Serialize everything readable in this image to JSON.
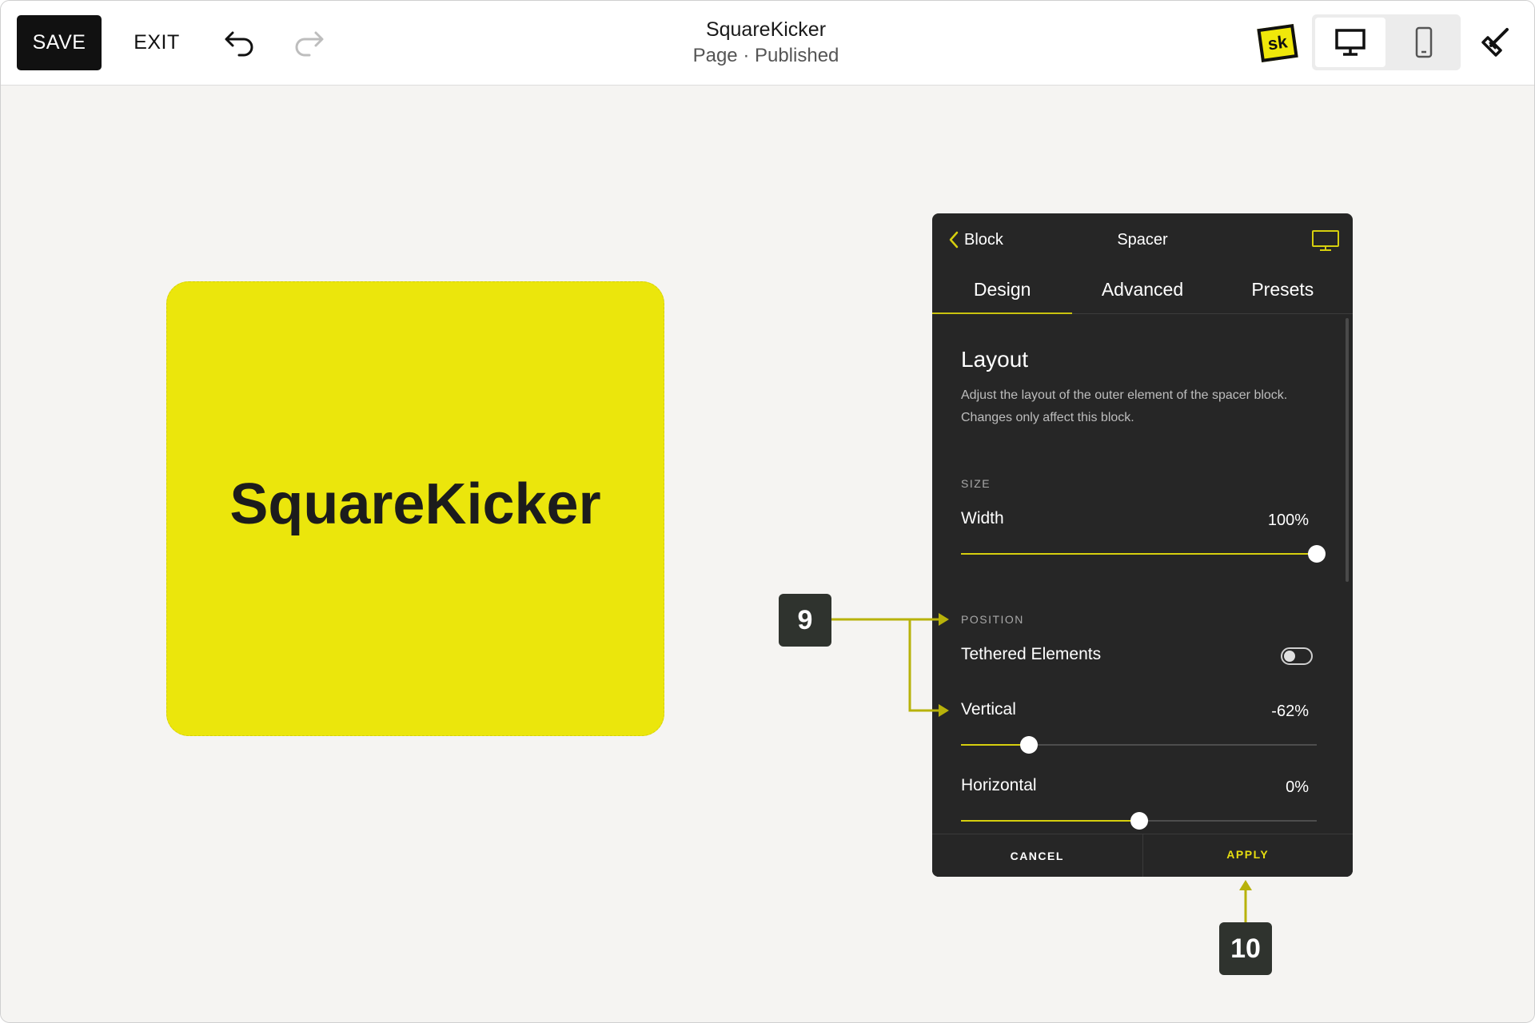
{
  "topbar": {
    "save_label": "SAVE",
    "exit_label": "EXIT",
    "site_title": "SquareKicker",
    "site_subtitle": "Page · Published",
    "logo_text": "sk"
  },
  "canvas": {
    "block_text": "SquareKicker",
    "block_color": "#ebe60c"
  },
  "panel": {
    "back_label": "Block",
    "title": "Spacer",
    "tabs": [
      {
        "label": "Design",
        "active": true
      },
      {
        "label": "Advanced",
        "active": false
      },
      {
        "label": "Presets",
        "active": false
      }
    ],
    "section_title": "Layout",
    "section_description": "Adjust the layout of the outer element of the spacer block. Changes only affect this block.",
    "size_group_label": "SIZE",
    "width": {
      "label": "Width",
      "value_text": "100%",
      "value": 100
    },
    "position_group_label": "POSITION",
    "tethered": {
      "label": "Tethered Elements",
      "on": false
    },
    "vertical": {
      "label": "Vertical",
      "value_text": "-62%",
      "value": -62
    },
    "horizontal": {
      "label": "Horizontal",
      "value_text": "0%",
      "value": 0
    },
    "cancel_label": "CANCEL",
    "apply_label": "APPLY",
    "accent_color": "#d6cf0e"
  },
  "callouts": [
    {
      "number": "9"
    },
    {
      "number": "10"
    }
  ]
}
